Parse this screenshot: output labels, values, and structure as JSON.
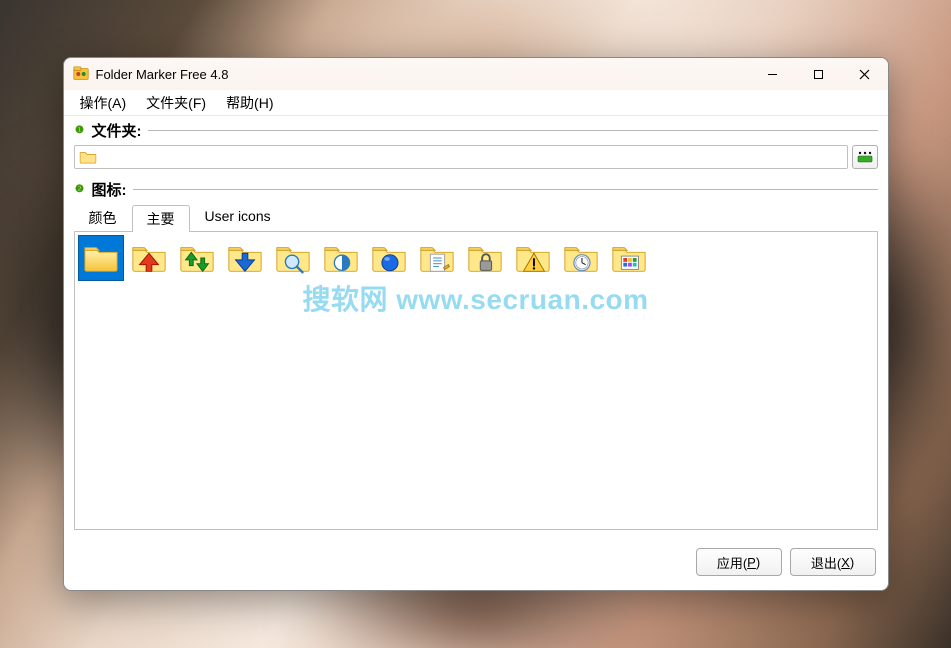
{
  "window": {
    "title": "Folder Marker Free 4.8"
  },
  "menu": {
    "action": "操作(A)",
    "folder": "文件夹(F)",
    "help": "帮助(H)"
  },
  "section": {
    "folder_badge": "❶",
    "folder_label": "文件夹:",
    "icon_badge": "❷",
    "icon_label": "图标:"
  },
  "tabs": {
    "color": "颜色",
    "main": "主要",
    "user": "User icons"
  },
  "folder_path_value": "",
  "icons": [
    {
      "name": "folder-plain"
    },
    {
      "name": "folder-arrow-up-red"
    },
    {
      "name": "folder-arrows-updown-green"
    },
    {
      "name": "folder-arrow-down-blue"
    },
    {
      "name": "folder-search"
    },
    {
      "name": "folder-half-circle"
    },
    {
      "name": "folder-blue-dot"
    },
    {
      "name": "folder-document"
    },
    {
      "name": "folder-lock"
    },
    {
      "name": "folder-warning"
    },
    {
      "name": "folder-clock"
    },
    {
      "name": "folder-color-grid"
    }
  ],
  "buttons": {
    "apply": "应用(",
    "apply_key": "P",
    "apply_end": ")",
    "exit": "退出(",
    "exit_key": "X",
    "exit_end": ")"
  },
  "watermark": "搜软网 www.secruan.com"
}
